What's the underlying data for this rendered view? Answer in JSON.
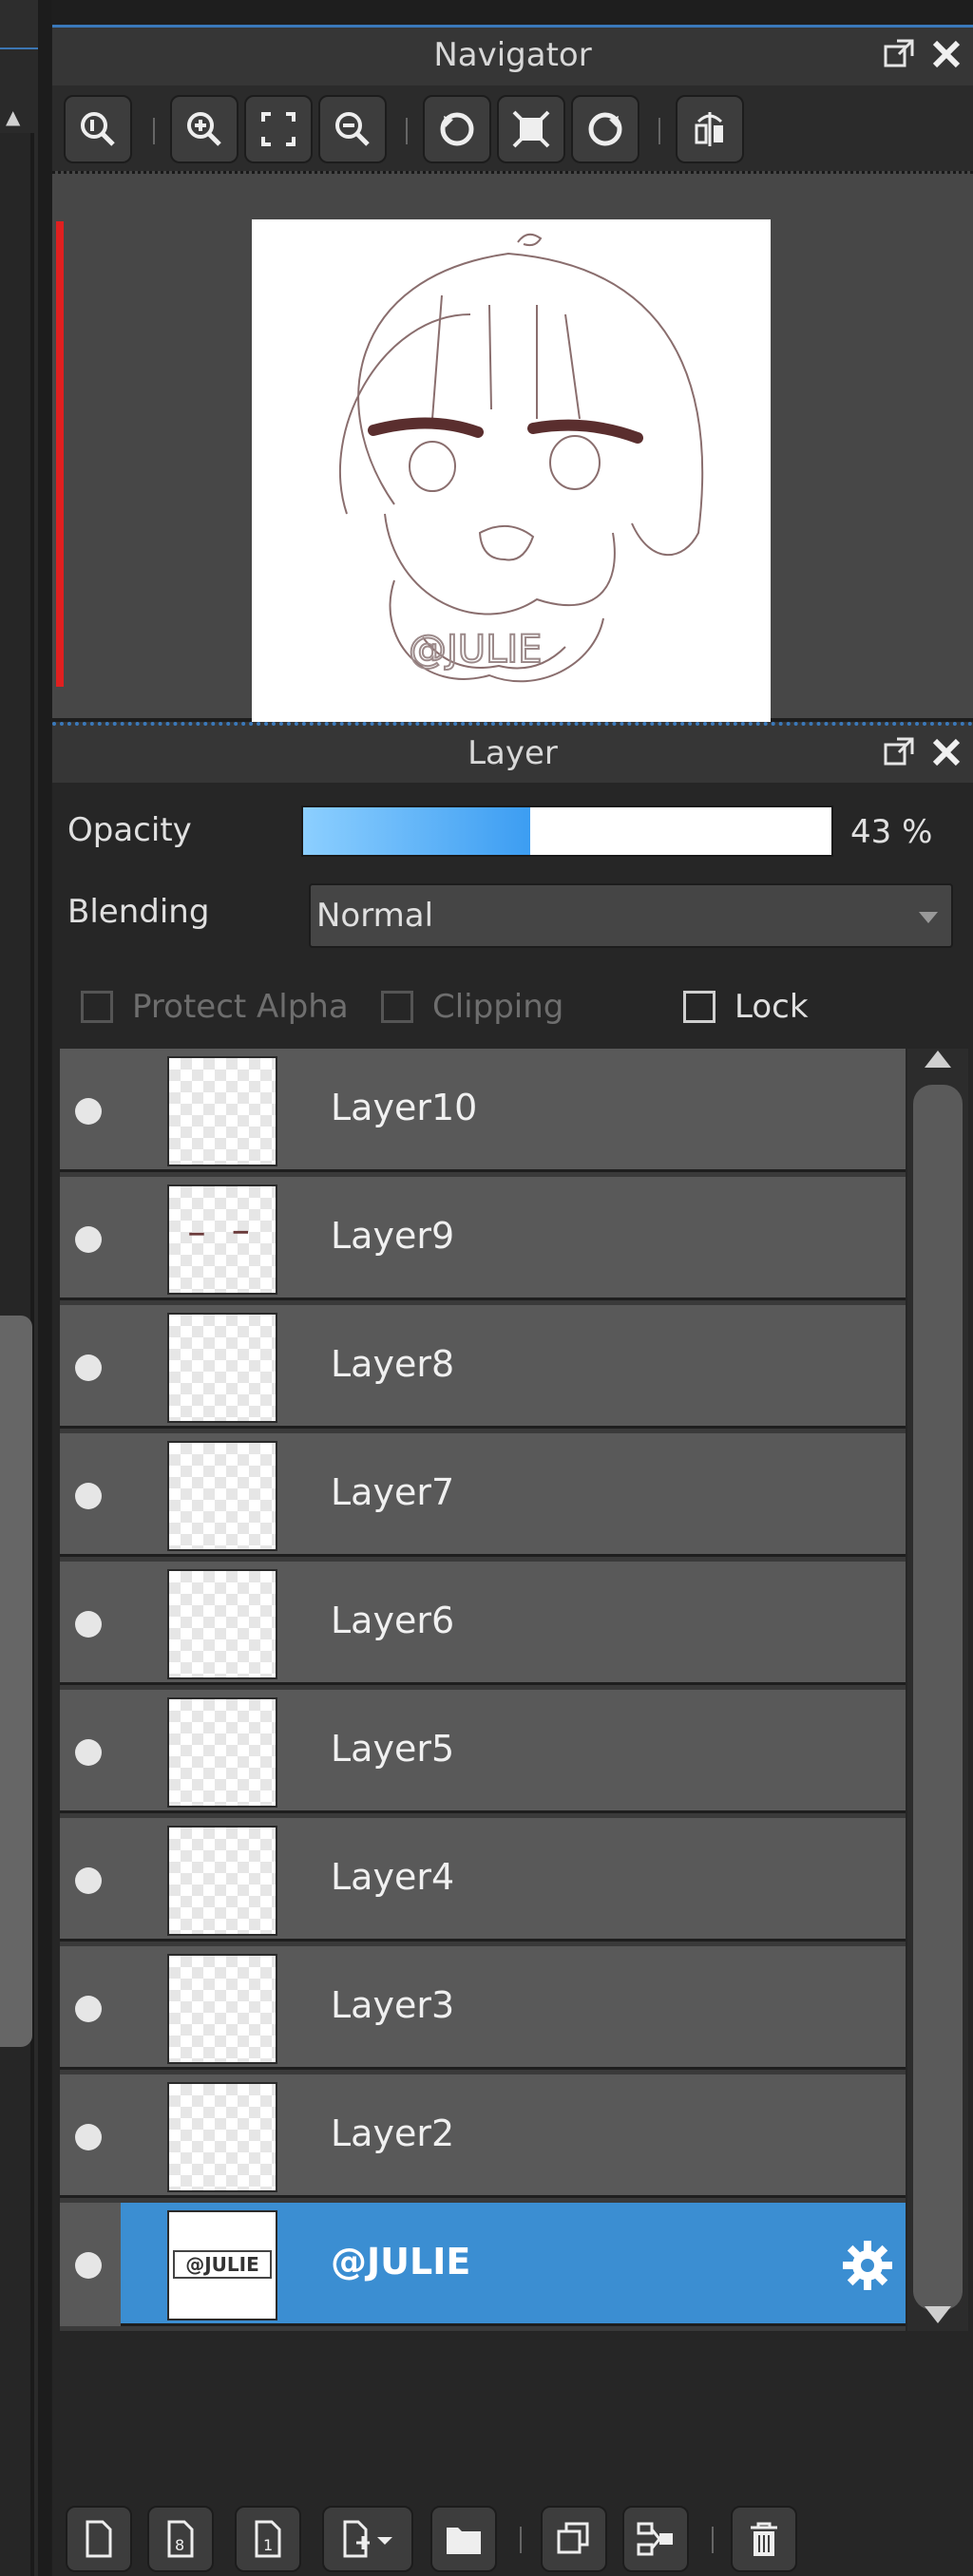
{
  "navigator": {
    "title": "Navigator",
    "canvas_watermark": "@JULIE",
    "tools": [
      "zoom-actual-icon",
      "zoom-in-icon",
      "fit-icon",
      "zoom-out-icon",
      "rotate-left-icon",
      "fullscreen-icon",
      "rotate-right-icon",
      "flip-icon"
    ]
  },
  "layer_panel": {
    "title": "Layer",
    "opacity_label": "Opacity",
    "opacity_value": "43 %",
    "opacity_fraction": 0.43,
    "blending_label": "Blending",
    "blending_value": "Normal",
    "protect_alpha_label": "Protect Alpha",
    "clipping_label": "Clipping",
    "lock_label": "Lock",
    "layers": [
      {
        "name": "Layer10"
      },
      {
        "name": "Layer9"
      },
      {
        "name": "Layer8"
      },
      {
        "name": "Layer7"
      },
      {
        "name": "Layer6"
      },
      {
        "name": "Layer5"
      },
      {
        "name": "Layer4"
      },
      {
        "name": "Layer3"
      },
      {
        "name": "Layer2"
      },
      {
        "name": "@JULIE",
        "selected": true
      }
    ],
    "selected_color": "#3b8ed2"
  }
}
